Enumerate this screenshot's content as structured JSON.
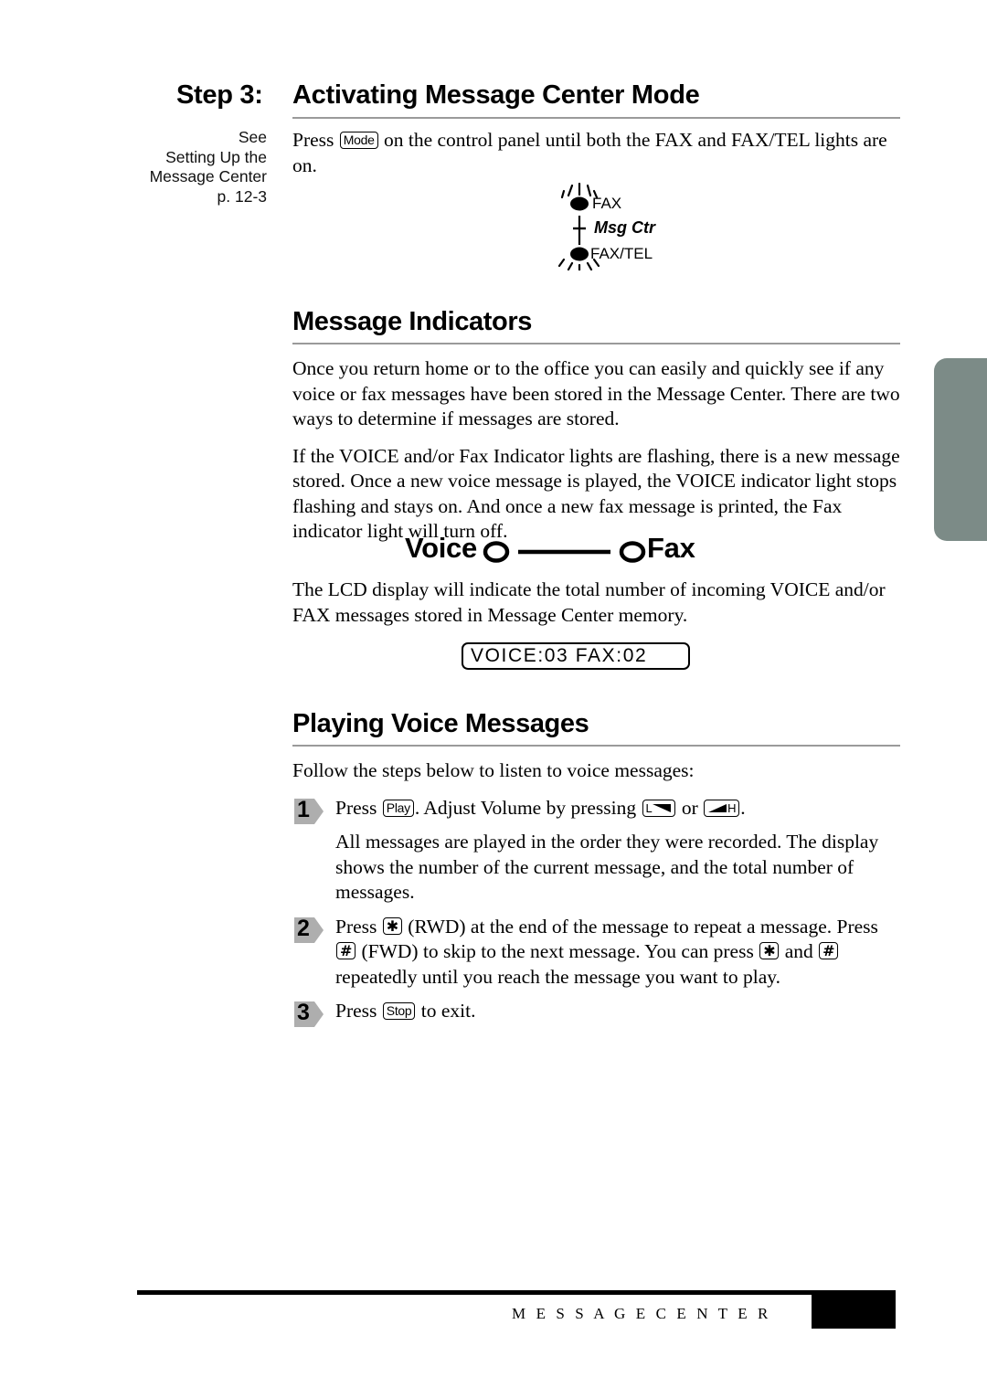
{
  "header": {
    "step_label": "Step 3:",
    "step_title": "Activating Message Center Mode"
  },
  "margin_note": {
    "line1": "See",
    "line2": "Setting Up the",
    "line3": "Message Center",
    "line4": "p. 12-3"
  },
  "intro": {
    "text_before_key": "Press",
    "key_mode": "Mode",
    "text_after_key": "on the control panel until both the FAX and FAX/TEL lights are on."
  },
  "led_diagram": {
    "fax_label": "FAX",
    "msg_ctr_label": "Msg Ctr",
    "fax_tel_label": "FAX/TEL"
  },
  "message_indicators": {
    "heading": "Message Indicators",
    "para1": "Once you return home or to the office you can easily and quickly see if any voice or fax messages have been stored in the Message Center. There are two ways to determine if messages are stored.",
    "para2": "If the VOICE and/or Fax Indicator lights are flashing, there is a new message stored. Once a new voice message is played, the VOICE indicator light stops flashing and stays on. And once a new fax message is printed, the Fax indicator light will turn off.",
    "voice_label": "Voice",
    "fax_label": "Fax",
    "para3": "The LCD display will indicate the total number of incoming VOICE and/or FAX messages stored in Message Center memory.",
    "lcd_text": "VOICE:03 FAX:02"
  },
  "playing_voice_messages": {
    "heading": "Playing Voice Messages",
    "intro": "Follow the steps below to listen to voice messages:",
    "steps": [
      {
        "num": "1",
        "t1": "Press",
        "key1": "Play",
        "t2": ". Adjust Volume by pressing",
        "key2": "L",
        "t3": "or",
        "key3": "H",
        "t4": ".",
        "sub": "All messages are played in the order they were recorded. The display shows the number of the current message, and the total number of messages."
      },
      {
        "num": "2",
        "t1": "Press",
        "key1": "✱",
        "t2": "(RWD) at the end of the message to repeat a message. Press",
        "key2": "#",
        "t3": "(FWD) to skip to the next message. You can press",
        "key3": "✱",
        "t4": "and",
        "key4": "#",
        "t5": "repeatedly until you reach the message you want to play."
      },
      {
        "num": "3",
        "t1": "Press",
        "key1": "Stop",
        "t2": "to exit."
      }
    ]
  },
  "footer": {
    "text": "M E S S A G E   C E N T E R"
  },
  "colors": {
    "edge_tab": "#7c8b87",
    "rule": "#9a9a9a",
    "step_marker": "#aeaeae"
  }
}
